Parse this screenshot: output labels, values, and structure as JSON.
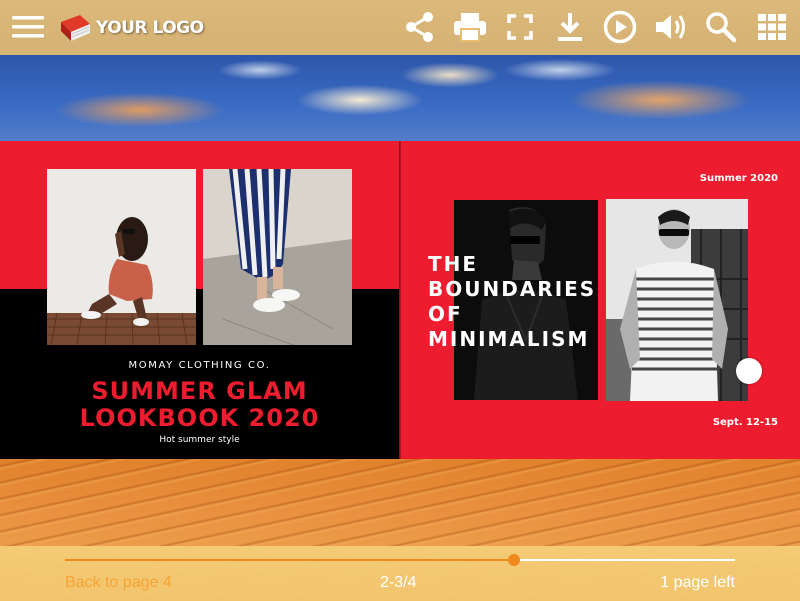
{
  "toolbar": {
    "logo_text": "YOUR LOGO",
    "icons": [
      "menu-icon",
      "share-icon",
      "print-icon",
      "fullscreen-icon",
      "download-icon",
      "play-icon",
      "volume-icon",
      "search-icon",
      "grid-icon"
    ]
  },
  "left_page": {
    "brand": "MOMAY CLOTHING CO.",
    "title_line1": "SUMMER GLAM",
    "title_line2": "LOOKBOOK 2020",
    "tagline": "Hot summer style"
  },
  "right_page": {
    "season": "Summer 2020",
    "headline_line1": "THE",
    "headline_line2": "BOUNDARIES",
    "headline_line3": "OF",
    "headline_line4": "MINIMALISM",
    "dates": "Sept. 12-15"
  },
  "navigation": {
    "back_label": "Back to page 4",
    "page_indicator": "2-3/4",
    "pages_left": "1 page left",
    "progress_fraction": 0.67
  },
  "colors": {
    "accent_red": "#ee1c2f",
    "toolbar_bg": "#ecc478",
    "progress_orange": "#f08a1c"
  }
}
